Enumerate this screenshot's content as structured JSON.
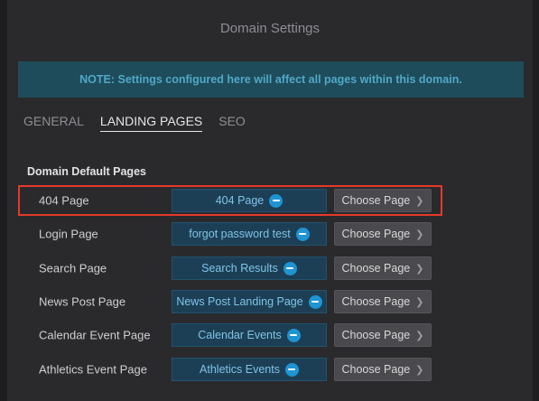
{
  "dialog": {
    "title": "Domain Settings"
  },
  "note": {
    "text": "NOTE: Settings configured here will affect all pages within this domain."
  },
  "tabs": [
    {
      "label": "GENERAL",
      "active": false
    },
    {
      "label": "LANDING PAGES",
      "active": true
    },
    {
      "label": "SEO",
      "active": false
    }
  ],
  "section": {
    "title": "Domain Default Pages"
  },
  "rows": [
    {
      "label": "404 Page",
      "page": "404 Page",
      "button": "Choose Page",
      "highlighted": true
    },
    {
      "label": "Login Page",
      "page": "forgot password test",
      "button": "Choose Page",
      "highlighted": false
    },
    {
      "label": "Search Page",
      "page": "Search Results",
      "button": "Choose Page",
      "highlighted": false
    },
    {
      "label": "News Post Page",
      "page": "News Post Landing Page",
      "button": "Choose Page",
      "highlighted": false
    },
    {
      "label": "Calendar Event Page",
      "page": "Calendar Events",
      "button": "Choose Page",
      "highlighted": false
    },
    {
      "label": "Athletics Event Page",
      "page": "Athletics Events",
      "button": "Choose Page",
      "highlighted": false
    }
  ],
  "icons": {
    "remove": "minus-circle-icon",
    "chevron": "chevron-right-icon"
  },
  "colors": {
    "highlight": "#e5392b",
    "accent": "#1e94d2",
    "note_bg": "#1f4c5a"
  }
}
